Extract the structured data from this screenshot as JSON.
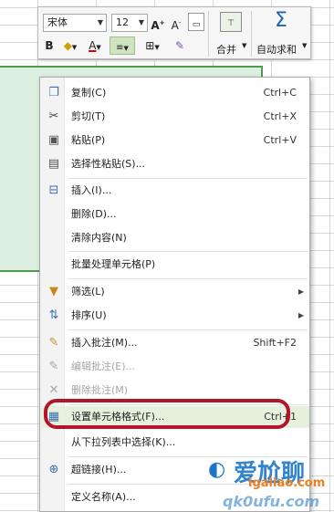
{
  "toolbar": {
    "font": "宋体",
    "size": "12",
    "grow": "A",
    "shrink": "A",
    "bold": "B",
    "font_color_letter": "A",
    "merge_label": "合并",
    "autosum_label": "自动求和",
    "sum_symbol": "Σ"
  },
  "menu": {
    "items": [
      {
        "label": "复制(C)",
        "shortcut": "Ctrl+C",
        "icon": "copy-icon"
      },
      {
        "label": "剪切(T)",
        "shortcut": "Ctrl+X",
        "icon": "scissors-icon"
      },
      {
        "label": "粘贴(P)",
        "shortcut": "Ctrl+V",
        "icon": "paste-icon"
      },
      {
        "label": "选择性粘贴(S)...",
        "shortcut": "",
        "icon": "paste-special-icon"
      },
      {
        "label": "插入(I)...",
        "shortcut": "",
        "icon": "insert-cells-icon"
      },
      {
        "label": "删除(D)...",
        "shortcut": "",
        "icon": ""
      },
      {
        "label": "清除内容(N)",
        "shortcut": "",
        "icon": ""
      },
      {
        "label": "批量处理单元格(P)",
        "shortcut": "",
        "icon": ""
      },
      {
        "label": "筛选(L)",
        "shortcut": "",
        "icon": "filter-icon"
      },
      {
        "label": "排序(U)",
        "shortcut": "",
        "icon": "sort-icon"
      },
      {
        "label": "插入批注(M)...",
        "shortcut": "Shift+F2",
        "icon": "insert-comment-icon"
      },
      {
        "label": "编辑批注(E)...",
        "shortcut": "",
        "icon": "edit-comment-icon"
      },
      {
        "label": "删除批注(M)",
        "shortcut": "",
        "icon": "delete-comment-icon"
      },
      {
        "label": "设置单元格格式(F)...",
        "shortcut": "Ctrl+1",
        "icon": "format-cells-icon"
      },
      {
        "label": "从下拉列表中选择(K)...",
        "shortcut": "",
        "icon": ""
      },
      {
        "label": "超链接(H)...",
        "shortcut": "",
        "icon": "hyperlink-icon"
      },
      {
        "label": "定义名称(A)...",
        "shortcut": "",
        "icon": ""
      }
    ]
  },
  "watermark": {
    "brand": "爱尬聊",
    "url": "igaliao.com",
    "url2": "qk0ufu.com"
  },
  "colors": {
    "highlight_outline": "#b3162a",
    "selection_fill": "#dceedd",
    "selection_border": "#4f9a4f"
  }
}
